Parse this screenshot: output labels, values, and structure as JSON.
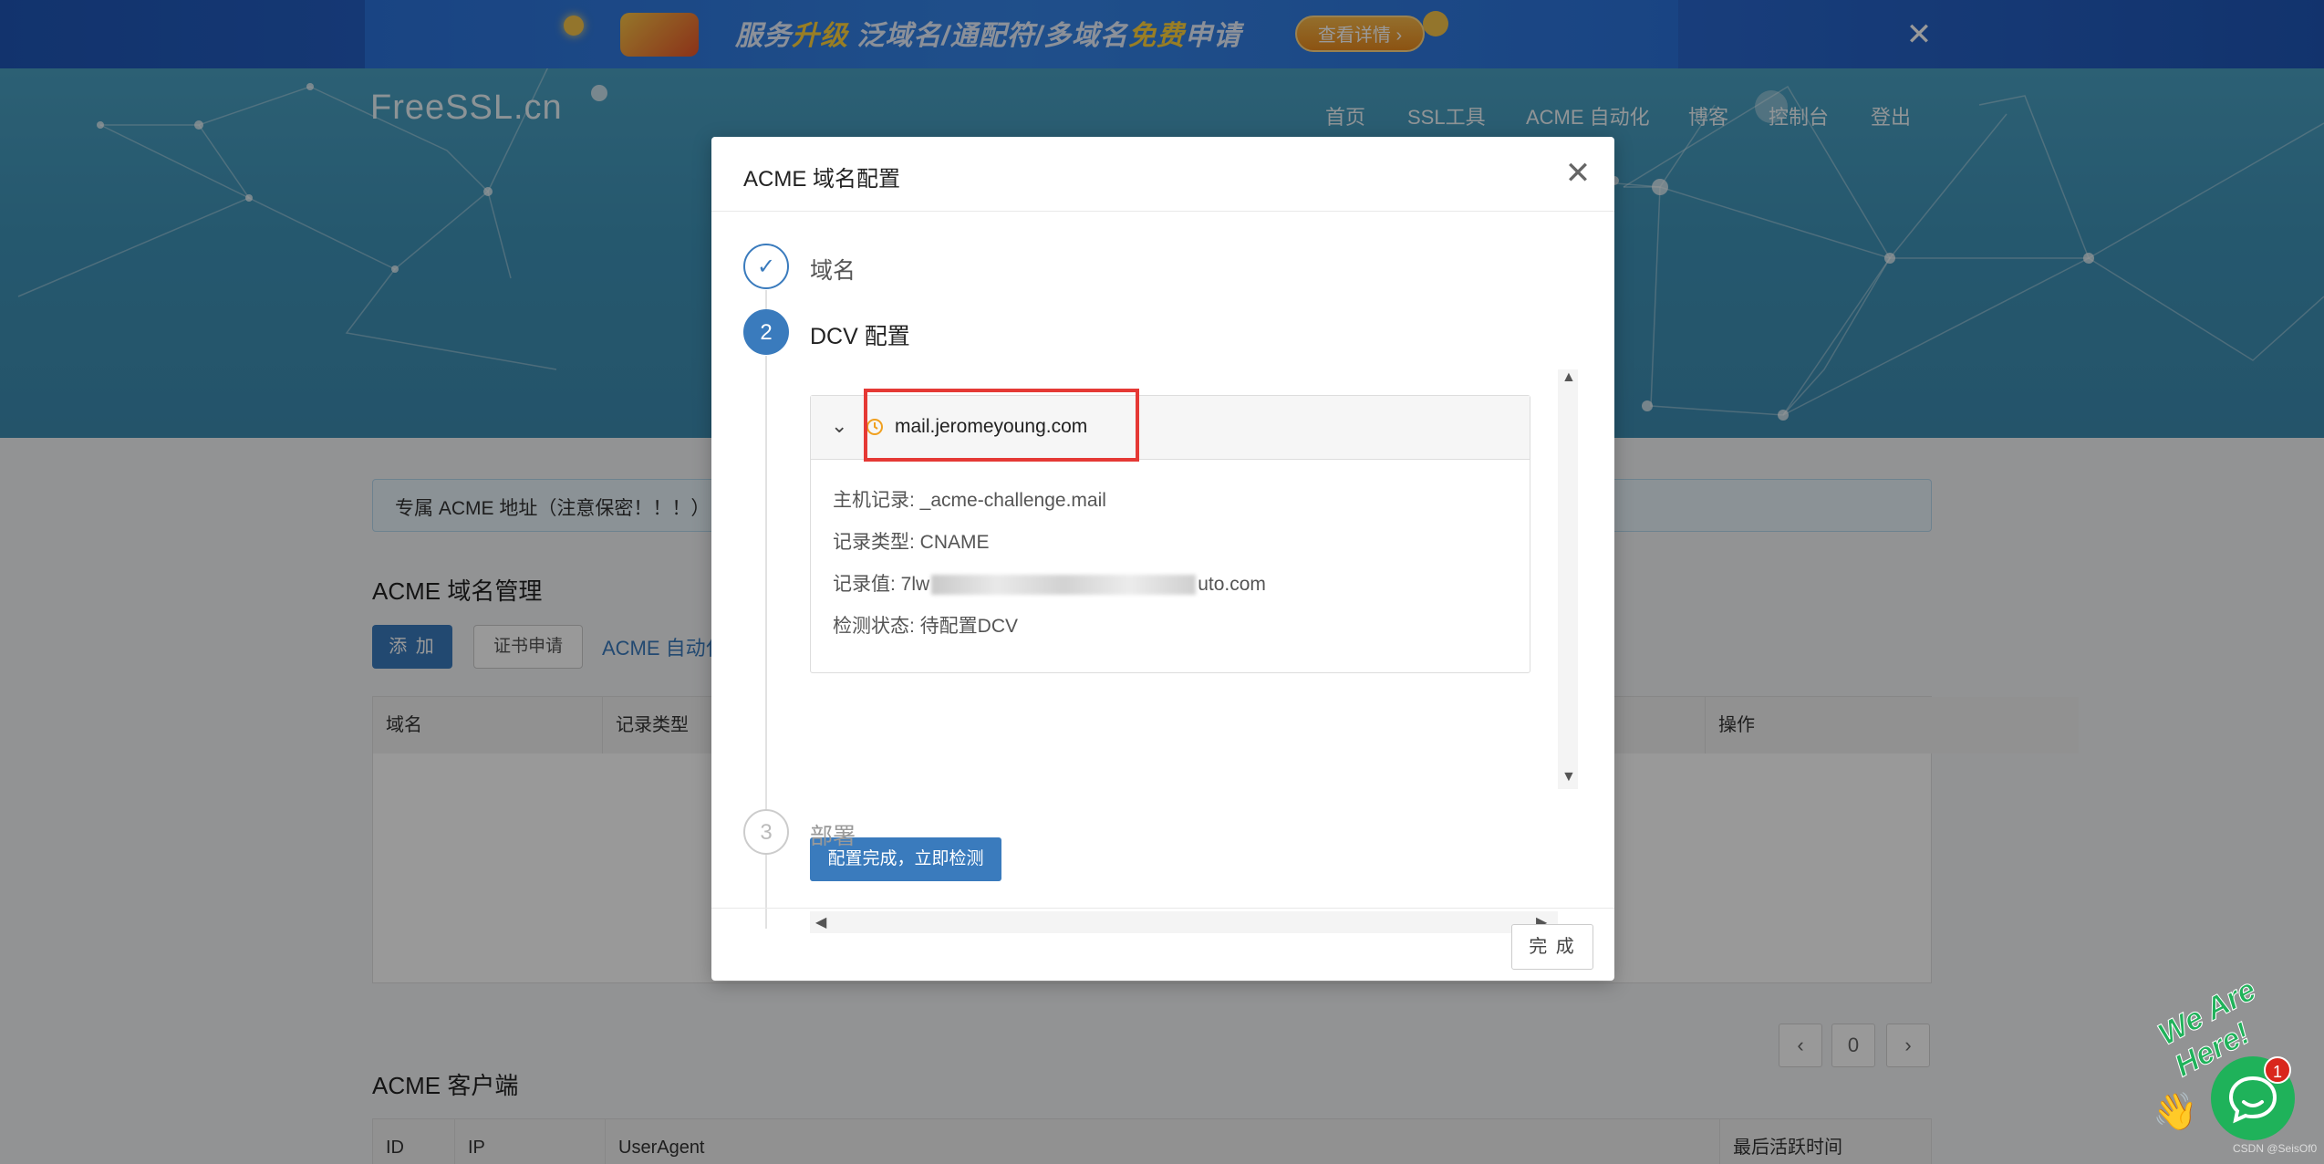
{
  "promo": {
    "text_a": "服务",
    "text_b": "升级",
    "text_c": " 泛域名/通配符/多域名",
    "text_d": "免费",
    "text_e": "申请",
    "button": "查看详情 ›",
    "close": "✕"
  },
  "header": {
    "logo": "FreeSSL.cn",
    "nav": [
      "首页",
      "SSL工具",
      "ACME 自动化",
      "博客",
      "控制台",
      "登出"
    ]
  },
  "page": {
    "alert": "专属 ACME 地址（注意保密！！！）",
    "domain_section_title": "ACME 域名管理",
    "add_button": "添 加",
    "cert_button": "证书申请",
    "acme_link": "ACME 自动化",
    "domain_table_headers": [
      "域名",
      "记录类型",
      "操作"
    ],
    "pager_prev": "‹",
    "pager_page": "0",
    "pager_next": "›",
    "client_section_title": "ACME 客户端",
    "client_table_headers": [
      "ID",
      "IP",
      "UserAgent",
      "最后活跃时间"
    ]
  },
  "modal": {
    "title": "ACME 域名配置",
    "close": "✕",
    "steps": [
      {
        "num": "✓",
        "label": "域名",
        "state": "done"
      },
      {
        "num": "2",
        "label": "DCV 配置",
        "state": "active"
      },
      {
        "num": "3",
        "label": "部署",
        "state": "wait"
      }
    ],
    "panel": {
      "domain": "mail.jeromeyoung.com",
      "host_record": "主机记录: _acme-challenge.mail",
      "record_type": "记录类型: CNAME",
      "record_value_prefix": "记录值: 7lw",
      "record_value_suffix": "uto.com",
      "status": "检测状态: 待配置DCV"
    },
    "check_button": "配置完成，立即检测",
    "finish_button": "完 成"
  },
  "chat": {
    "badge": "1",
    "slogan": "We Are Here!",
    "watermark": "CSDN @SeisOf0"
  },
  "colors": {
    "primary": "#3a7bbd",
    "highlight_box": "#e53935",
    "pending_icon": "#f0a020",
    "chat_green": "#1fb25a"
  }
}
